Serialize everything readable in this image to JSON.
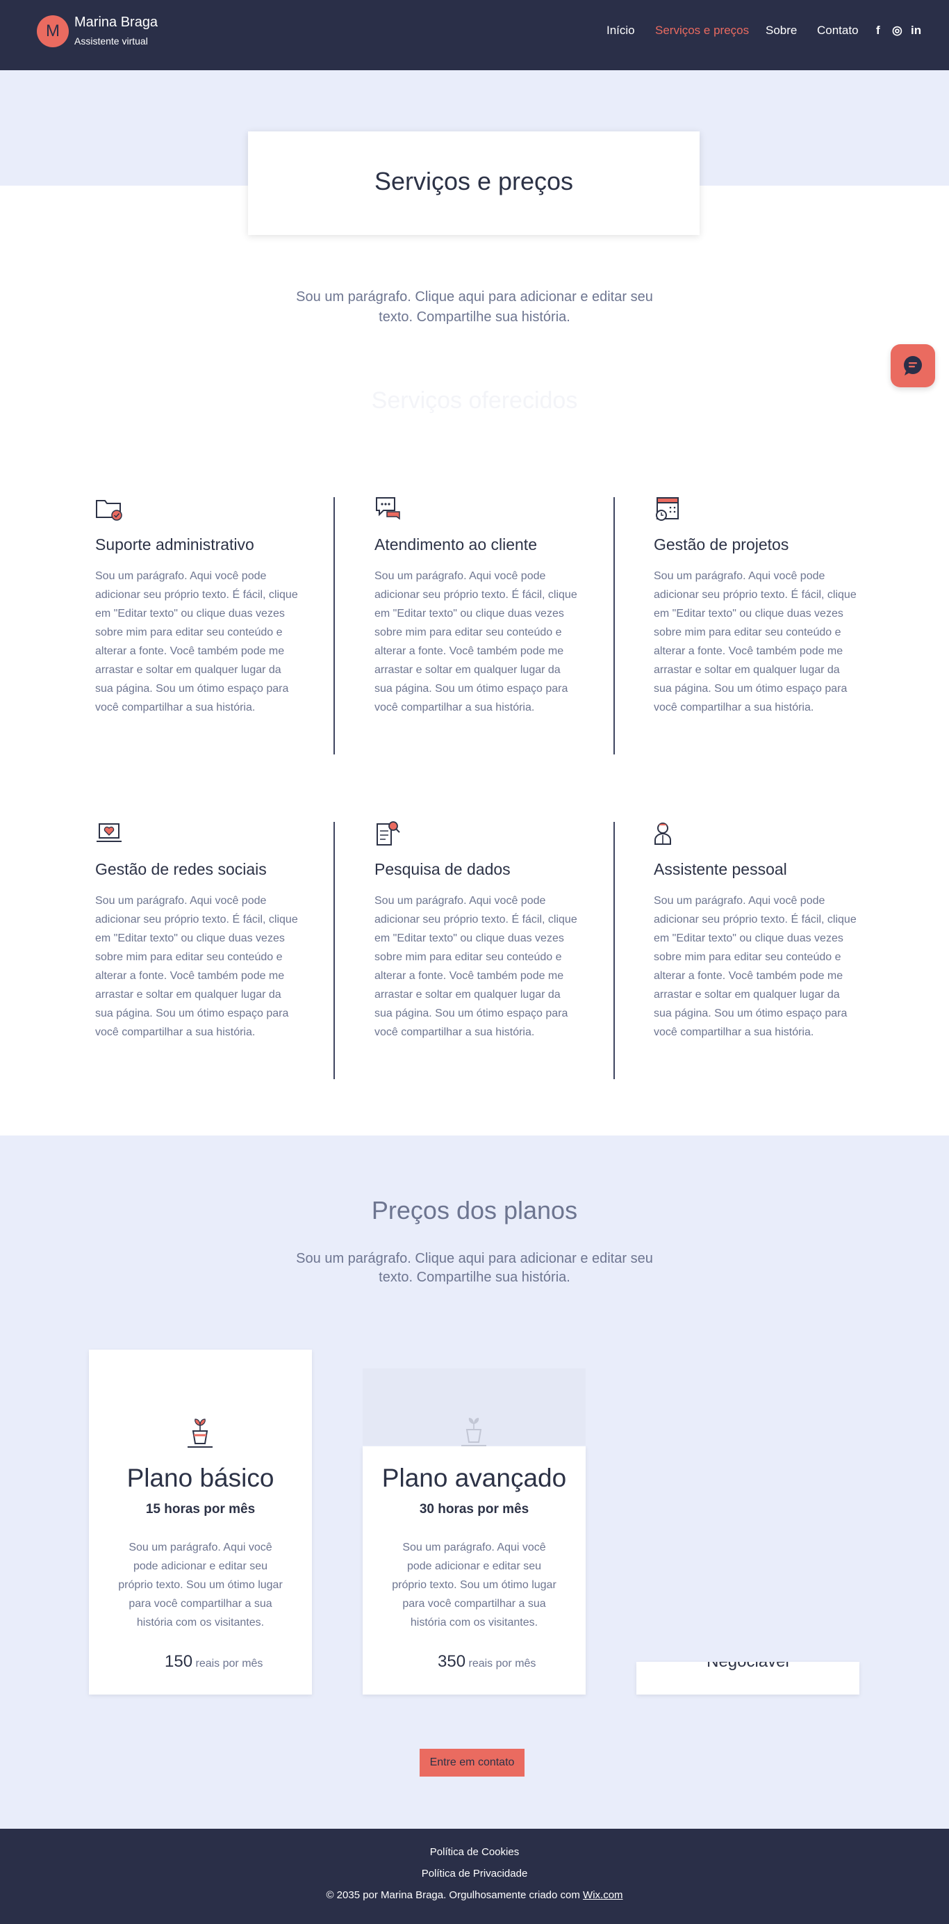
{
  "colors": {
    "header_bg": "#2a2f48",
    "accent": "#ea6b60",
    "hero_band": "#e9edfa",
    "text_dark": "#2c3246",
    "text_muted": "#6d7590"
  },
  "header": {
    "logo_letter": "M",
    "brand_name": "Marina Braga",
    "brand_subtitle": "Assistente virtual",
    "nav": [
      {
        "label": "Início",
        "active": false
      },
      {
        "label": "Serviços e preços",
        "active": true
      },
      {
        "label": "Sobre",
        "active": false
      },
      {
        "label": "Contato",
        "active": false
      }
    ],
    "social": [
      {
        "icon": "facebook-icon",
        "glyph": "f"
      },
      {
        "icon": "instagram-icon",
        "glyph": "◎"
      },
      {
        "icon": "linkedin-icon",
        "glyph": "in"
      }
    ]
  },
  "hero": {
    "title": "Serviços e preços",
    "paragraph": "Sou um parágrafo. Clique aqui para adicionar e editar seu texto. Compartilhe sua história."
  },
  "services_heading": "Serviços oferecidos",
  "services": [
    {
      "icon": "folder-check-icon",
      "title": "Suporte administrativo",
      "text": "Sou um parágrafo. Aqui você pode adicionar seu próprio texto. É fácil, clique em \"Editar texto\" ou clique duas vezes sobre mim para editar seu conteúdo e alterar a fonte. Você também pode me arrastar e soltar em qualquer lugar da sua página. Sou um ótimo espaço para você compartilhar a sua história."
    },
    {
      "icon": "chat-bubbles-icon",
      "title": "Atendimento ao cliente",
      "text": "Sou um parágrafo. Aqui você pode adicionar seu próprio texto. É fácil, clique em \"Editar texto\" ou clique duas vezes sobre mim para editar seu conteúdo e alterar a fonte. Você também pode me arrastar e soltar em qualquer lugar da sua página. Sou um ótimo espaço para você compartilhar a sua história."
    },
    {
      "icon": "calendar-clock-icon",
      "title": "Gestão de projetos",
      "text": "Sou um parágrafo. Aqui você pode adicionar seu próprio texto. É fácil, clique em \"Editar texto\" ou clique duas vezes sobre mim para editar seu conteúdo e alterar a fonte. Você também pode me arrastar e soltar em qualquer lugar da sua página. Sou um ótimo espaço para você compartilhar a sua história."
    },
    {
      "icon": "laptop-heart-icon",
      "title": "Gestão de redes sociais",
      "text": "Sou um parágrafo. Aqui você pode adicionar seu próprio texto. É fácil, clique em \"Editar texto\" ou clique duas vezes sobre mim para editar seu conteúdo e alterar a fonte. Você também pode me arrastar e soltar em qualquer lugar da sua página. Sou um ótimo espaço para você compartilhar a sua história."
    },
    {
      "icon": "document-search-icon",
      "title": "Pesquisa de dados",
      "text": "Sou um parágrafo. Aqui você pode adicionar seu próprio texto. É fácil, clique em \"Editar texto\" ou clique duas vezes sobre mim para editar seu conteúdo e alterar a fonte. Você também pode me arrastar e soltar em qualquer lugar da sua página. Sou um ótimo espaço para você compartilhar a sua história."
    },
    {
      "icon": "assistant-person-icon",
      "title": "Assistente pessoal",
      "text": "Sou um parágrafo. Aqui você pode adicionar seu próprio texto. É fácil, clique em \"Editar texto\" ou clique duas vezes sobre mim para editar seu conteúdo e alterar a fonte. Você também pode me arrastar e soltar em qualquer lugar da sua página. Sou um ótimo espaço para você compartilhar a sua história."
    }
  ],
  "pricing": {
    "title": "Preços dos planos",
    "paragraph": "Sou um parágrafo. Clique aqui para adicionar e editar seu texto. Compartilhe sua história.",
    "plans": [
      {
        "icon": "plant-pot-icon",
        "name": "Plano básico",
        "hours": "15 horas por mês",
        "desc": "Sou um parágrafo. Aqui você pode adicionar e editar seu próprio texto. Sou um ótimo lugar para você compartilhar a sua história com os visitantes.",
        "price": "150",
        "unit": "reais por mês"
      },
      {
        "icon": "plant-pot-icon",
        "name": "Plano avançado",
        "hours": "30 horas por mês",
        "desc": "Sou um parágrafo. Aqui você pode adicionar e editar seu próprio texto. Sou um ótimo lugar para você compartilhar a sua história com os visitantes.",
        "price": "350",
        "unit": "reais por mês"
      },
      {
        "price_text": "Negociável"
      }
    ],
    "cta": "Entre em contato"
  },
  "footer": {
    "cookies": "Política de Cookies",
    "privacy": "Política de Privacidade",
    "copyright": "© 2035 por Marina Braga. Orgulhosamente criado com",
    "wix": "Wix.com"
  }
}
